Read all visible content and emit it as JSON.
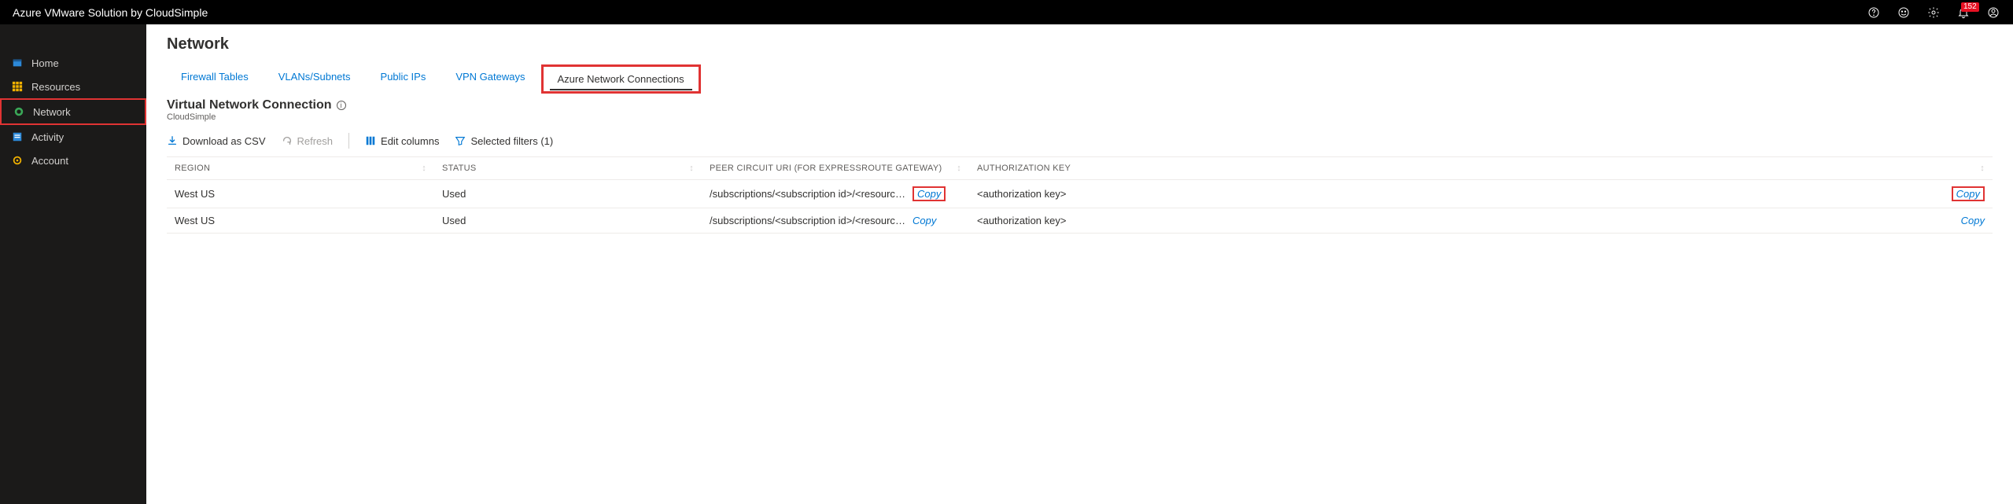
{
  "topbar": {
    "title": "Azure VMware Solution by CloudSimple",
    "notif_count": "152"
  },
  "sidebar": {
    "items": [
      {
        "label": "Home"
      },
      {
        "label": "Resources"
      },
      {
        "label": "Network"
      },
      {
        "label": "Activity"
      },
      {
        "label": "Account"
      }
    ]
  },
  "page": {
    "title": "Network",
    "tabs": [
      "Firewall Tables",
      "VLANs/Subnets",
      "Public IPs",
      "VPN Gateways",
      "Azure Network Connections"
    ],
    "sub_title": "Virtual Network Connection",
    "sub_org": "CloudSimple"
  },
  "toolbar": {
    "download": "Download as CSV",
    "refresh": "Refresh",
    "edit_cols": "Edit columns",
    "filters": "Selected filters (1)"
  },
  "table": {
    "headers": {
      "region": "Region",
      "status": "Status",
      "peer": "Peer Circuit URI (for ExpressRoute Gateway)",
      "key": "Authorization Key"
    },
    "rows": [
      {
        "region": "West US",
        "status": "Used",
        "peer": "/subscriptions/<subscription id>/<resource group/<circ…",
        "copy_peer": "Copy",
        "key": "<authorization key>",
        "copy_key": "Copy"
      },
      {
        "region": "West US",
        "status": "Used",
        "peer": "/subscriptions/<subscription id>/<resource group/<circ …",
        "copy_peer": "Copy",
        "key": "<authorization key>",
        "copy_key": "Copy"
      }
    ]
  }
}
